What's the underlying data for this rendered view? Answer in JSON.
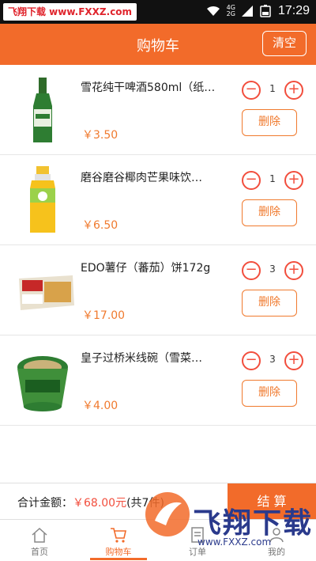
{
  "status_bar": {
    "watermark": "飞翔下载 www.FXXZ.com",
    "net_top": "4G",
    "net_bottom": "2G",
    "time": "17:29"
  },
  "header": {
    "title": "购物车",
    "clear_label": "清空"
  },
  "items": [
    {
      "name": "雪花纯干啤酒580ml（纸…",
      "price": "￥3.50",
      "qty": "1",
      "delete_label": "删除",
      "minus": "−",
      "plus": "+"
    },
    {
      "name": "磨谷磨谷椰肉芒果味饮…",
      "price": "￥6.50",
      "qty": "1",
      "delete_label": "删除",
      "minus": "−",
      "plus": "+"
    },
    {
      "name": "EDO薯仔（蕃茄）饼172g",
      "price": "￥17.00",
      "qty": "3",
      "delete_label": "删除",
      "minus": "−",
      "plus": "+"
    },
    {
      "name": "皇子过桥米线碗（雪菜…",
      "price": "￥4.00",
      "qty": "3",
      "delete_label": "删除",
      "minus": "−",
      "plus": "+"
    }
  ],
  "footer": {
    "total_prefix": "合计金额：",
    "total_amount": "￥68.00元",
    "total_count": "(共7件)",
    "checkout_label": "结 算"
  },
  "tabs": [
    {
      "label": "首页",
      "icon": "home-icon"
    },
    {
      "label": "购物车",
      "icon": "cart-icon",
      "active": true
    },
    {
      "label": "订单",
      "icon": "order-icon"
    },
    {
      "label": "我的",
      "icon": "profile-icon"
    }
  ],
  "logo_watermark": {
    "text": "飞翔下载",
    "url": "www.FXXZ.com"
  },
  "colors": {
    "accent": "#f26b2a",
    "price": "#f07a2e",
    "stepper": "#f24e3d"
  }
}
